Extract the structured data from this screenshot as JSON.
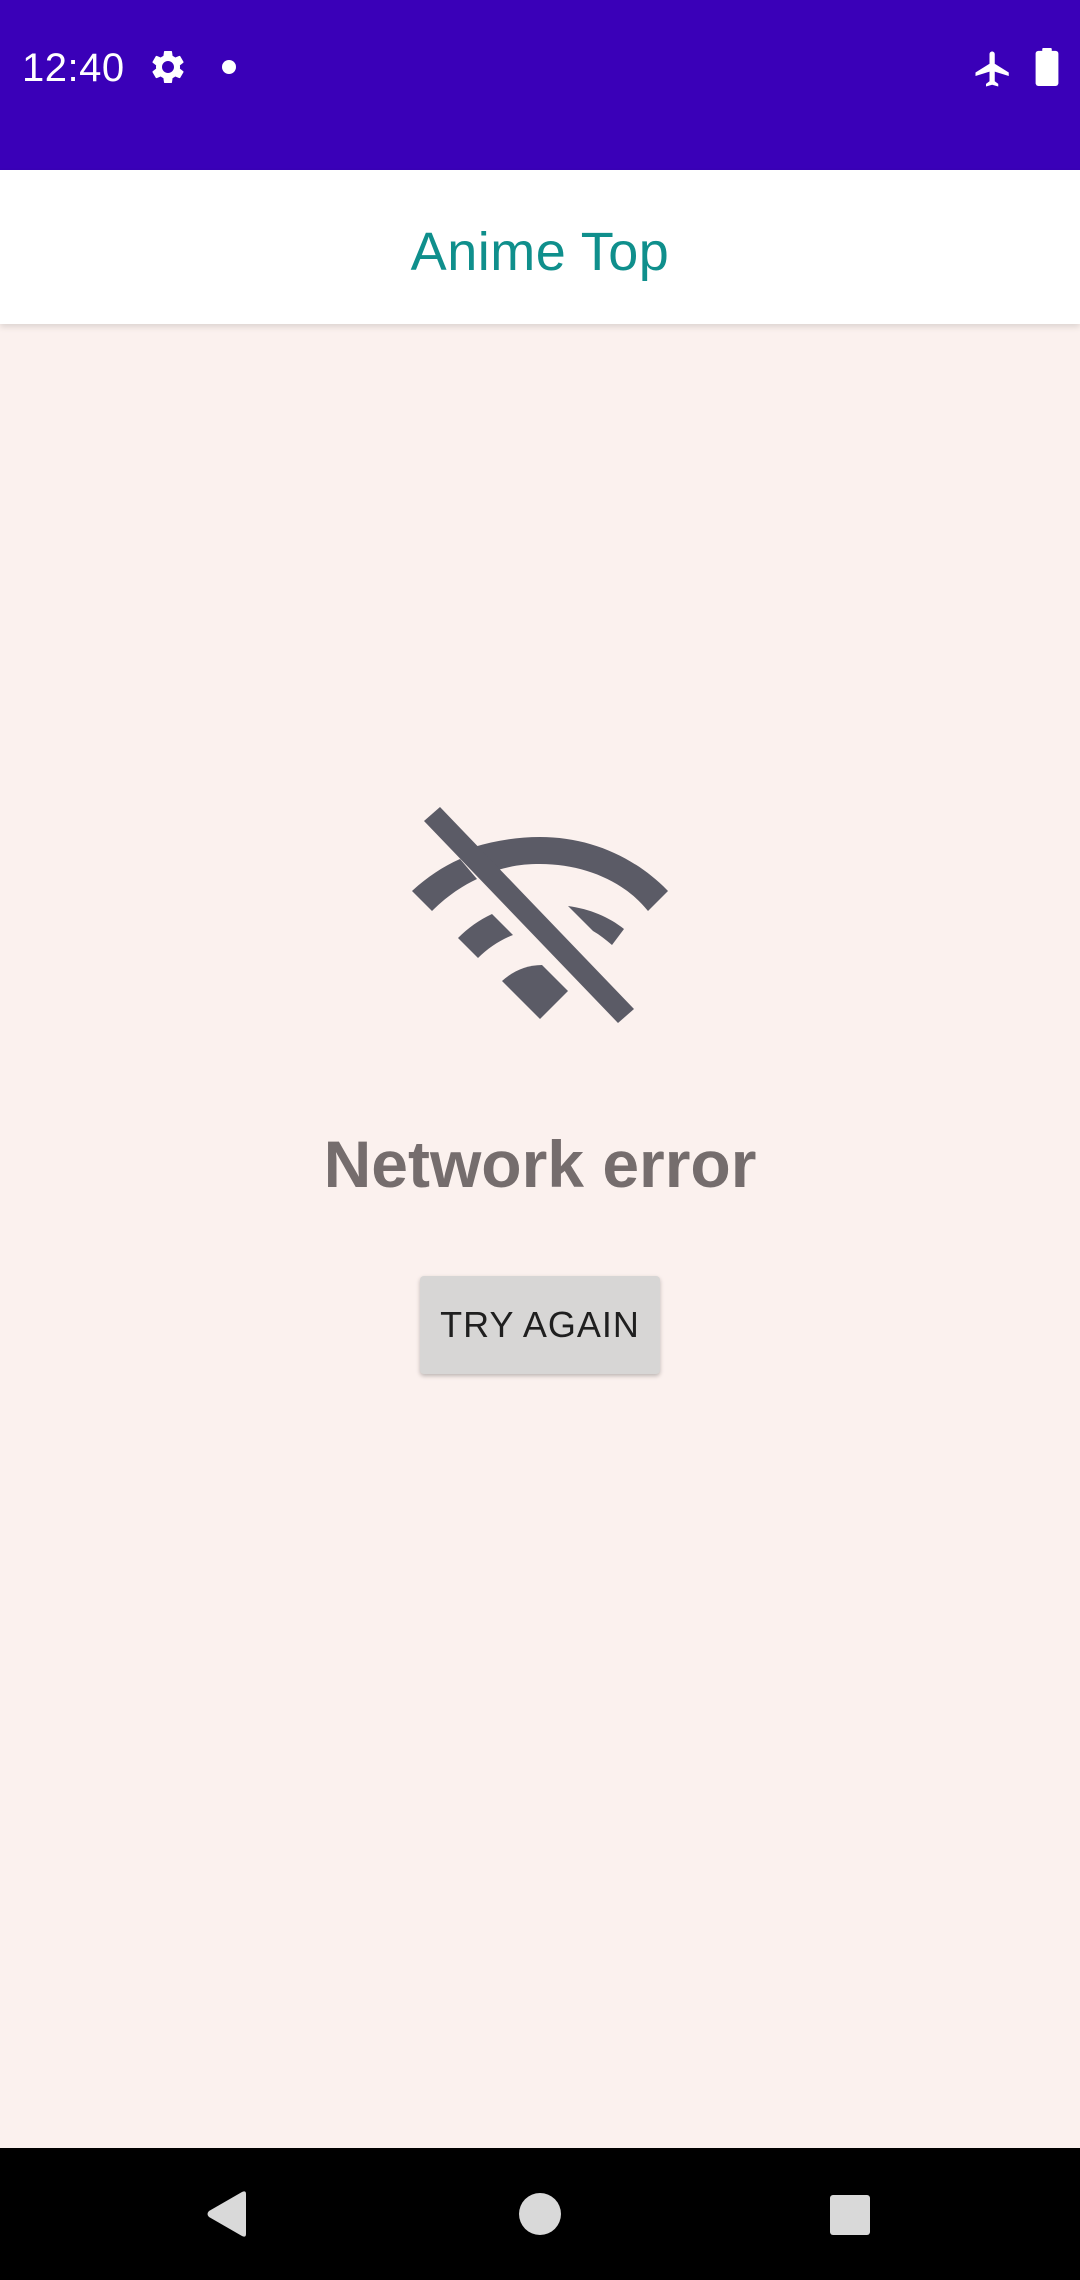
{
  "status_bar": {
    "time": "12:40",
    "icons": [
      "gear-icon",
      "notification-dot-icon",
      "airplane-mode-icon",
      "battery-icon"
    ],
    "background_color": "#3a00b8"
  },
  "app_bar": {
    "title": "Anime Top",
    "title_color": "#0f8f8c"
  },
  "error_state": {
    "icon": "wifi-off-icon",
    "message": "Network error",
    "retry_label": "TRY AGAIN"
  },
  "nav_bar": {
    "buttons": [
      "back-icon",
      "home-icon",
      "recents-icon"
    ]
  }
}
